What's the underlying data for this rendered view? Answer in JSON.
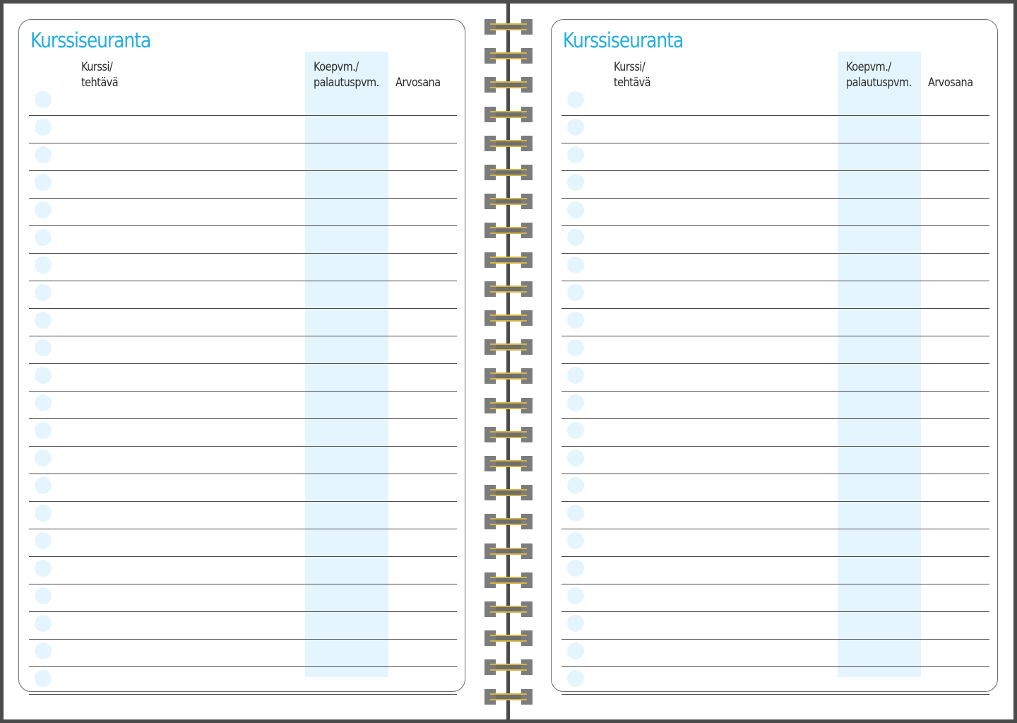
{
  "pages": [
    {
      "id": "left",
      "title": "Kurssiseuranta",
      "headers": {
        "course": "Kurssi/\ntehtävä",
        "date": "Koepvm./\npalautuspvm.",
        "grade": "Arvosana"
      }
    },
    {
      "id": "right",
      "title": "Kurssiseuranta",
      "headers": {
        "course": "Kurssi/\ntehtävä",
        "date": "Koepvm./\npalautuspvm.",
        "grade": "Arvosana"
      }
    }
  ],
  "rows_per_page": 22,
  "binding_rings": 24,
  "colors": {
    "title": "#22aee0",
    "band": "#e5f5fe",
    "frame": "#4b4b4b",
    "wire": "#d4b545",
    "tab": "#7c7c7c"
  }
}
